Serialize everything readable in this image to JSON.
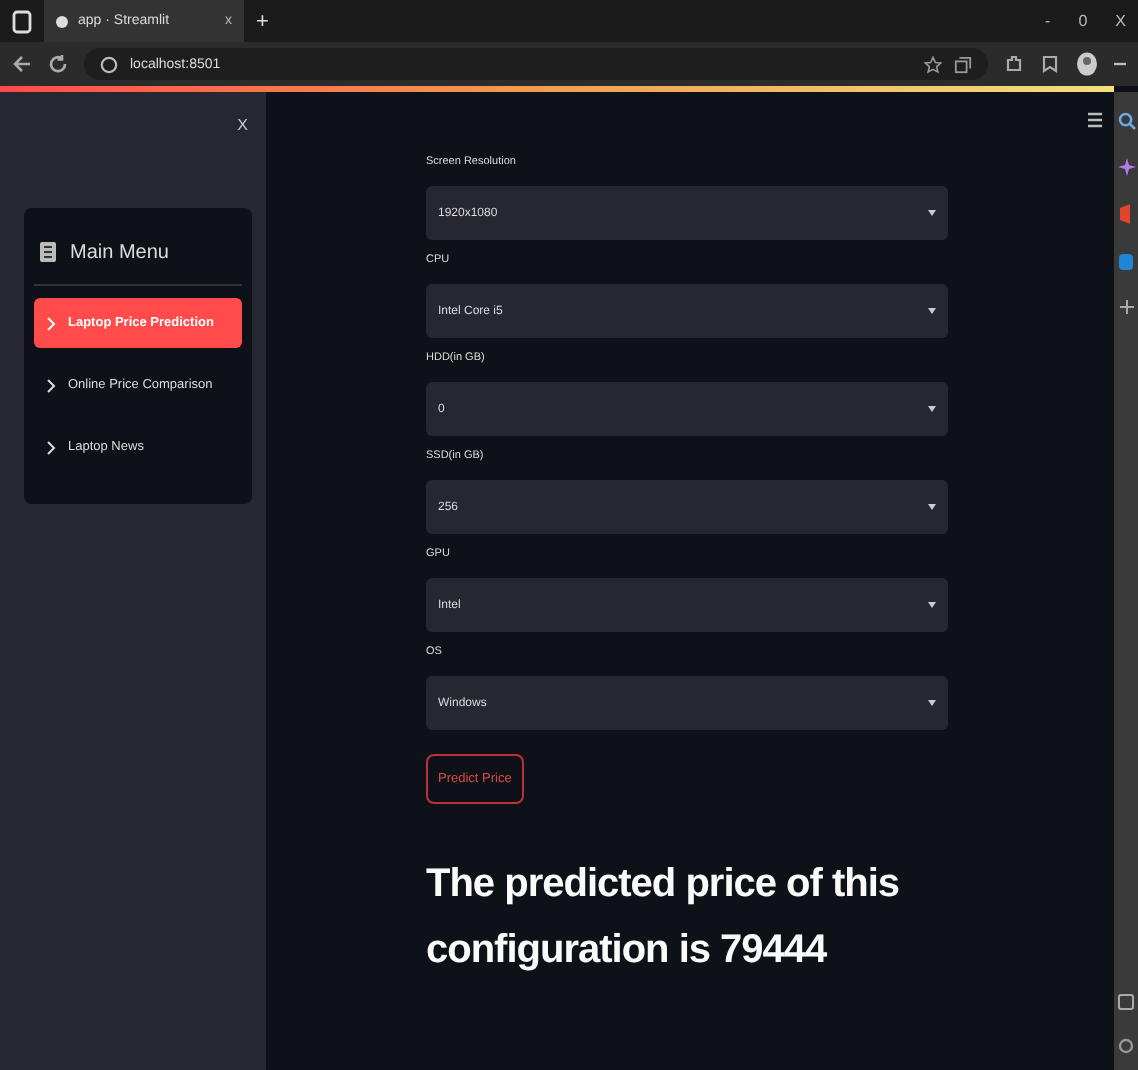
{
  "browser": {
    "tab_title": "app · Streamlit",
    "tab_close": "x",
    "new_tab": "+",
    "window_controls": [
      "-",
      "0",
      "X"
    ],
    "url": "localhost:8501"
  },
  "sidebar": {
    "close": "X",
    "menu_title": "Main Menu",
    "items": [
      {
        "label": "Laptop Price Prediction",
        "selected": true
      },
      {
        "label": "Online Price Comparison",
        "selected": false
      },
      {
        "label": "Laptop News",
        "selected": false
      }
    ]
  },
  "form": {
    "fields": [
      {
        "label": "Screen Resolution",
        "value": "1920x1080"
      },
      {
        "label": "CPU",
        "value": "Intel Core i5"
      },
      {
        "label": "HDD(in GB)",
        "value": "0"
      },
      {
        "label": "SSD(in GB)",
        "value": "256"
      },
      {
        "label": "GPU",
        "value": "Intel"
      },
      {
        "label": "OS",
        "value": "Windows"
      }
    ],
    "button": "Predict Price",
    "result": "The predicted price of this configuration is 79444"
  }
}
